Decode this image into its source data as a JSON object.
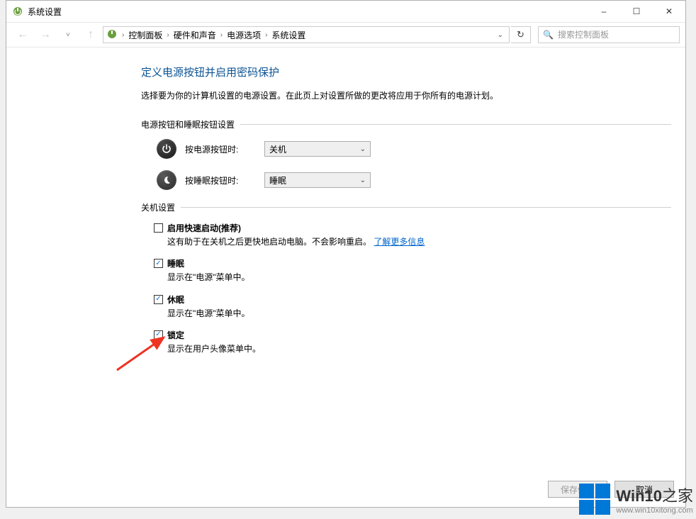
{
  "window": {
    "title": "系统设置",
    "minimize": "–",
    "maximize": "☐",
    "close": "✕"
  },
  "breadcrumb": {
    "items": [
      "控制面板",
      "硬件和声音",
      "电源选项",
      "系统设置"
    ]
  },
  "search": {
    "placeholder": "搜索控制面板"
  },
  "page": {
    "heading": "定义电源按钮并启用密码保护",
    "description": "选择要为你的计算机设置的电源设置。在此页上对设置所做的更改将应用于你所有的电源计划。",
    "group1_label": "电源按钮和睡眠按钮设置",
    "power_btn_label": "按电源按钮时:",
    "power_btn_value": "关机",
    "sleep_btn_label": "按睡眠按钮时:",
    "sleep_btn_value": "睡眠",
    "group2_label": "关机设置",
    "opts": [
      {
        "checked": false,
        "label": "启用快速启动(推荐)",
        "desc_before": "这有助于在关机之后更快地启动电脑。不会影响重启。",
        "link": "了解更多信息"
      },
      {
        "checked": true,
        "label": "睡眠",
        "desc": "显示在\"电源\"菜单中。"
      },
      {
        "checked": true,
        "label": "休眠",
        "desc": "显示在\"电源\"菜单中。"
      },
      {
        "checked": true,
        "label": "锁定",
        "desc": "显示在用户头像菜单中。"
      }
    ]
  },
  "buttons": {
    "save": "保存修改",
    "cancel": "取消"
  },
  "watermark": {
    "brand_prefix": "Win10",
    "brand_suffix": "之家",
    "url": "www.win10xitong.com"
  }
}
